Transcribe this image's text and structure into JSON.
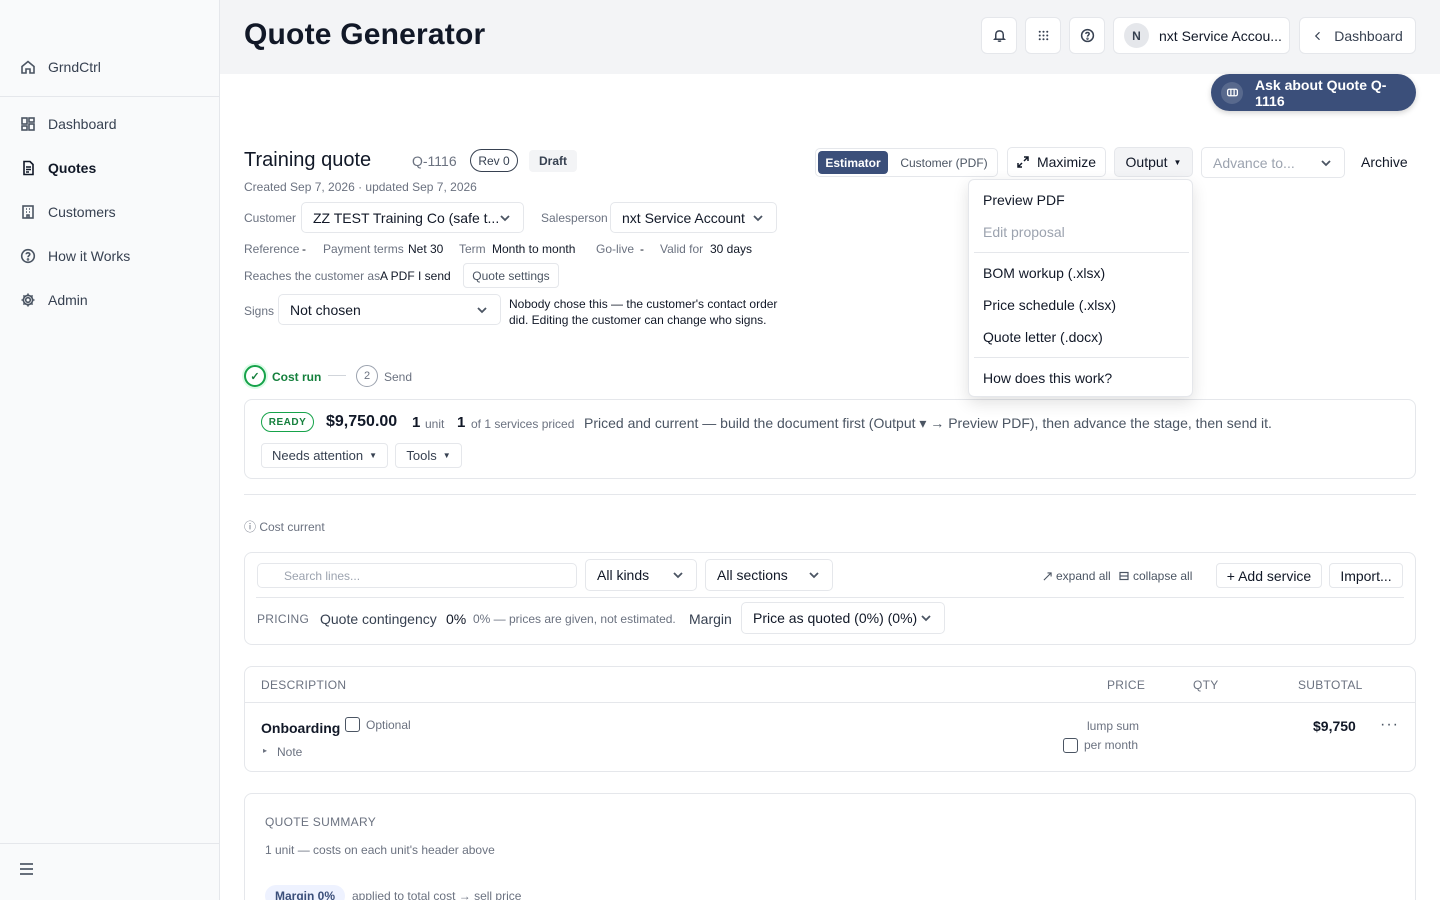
{
  "sidebar": {
    "brand": "GrndCtrl",
    "items": [
      {
        "label": "Dashboard",
        "icon": "dashboard-icon"
      },
      {
        "label": "Quotes",
        "icon": "document-icon"
      },
      {
        "label": "Customers",
        "icon": "building-icon"
      },
      {
        "label": "How it Works",
        "icon": "help-circle-icon"
      },
      {
        "label": "Admin",
        "icon": "gear-icon"
      }
    ]
  },
  "header": {
    "title": "Quote Generator",
    "account_initial": "N",
    "account_name": "nxt Service Accou...",
    "dashboard_link": "Dashboard"
  },
  "ask_button": "Ask about Quote Q-1116",
  "quote": {
    "title": "Training quote",
    "number": "Q-1116",
    "revision": "Rev 0",
    "status": "Draft",
    "created": "Created Sep 7, 2026 · updated Sep 7, 2026",
    "customer_label": "Customer",
    "customer_value": "ZZ TEST Training Co (safe t...",
    "salesperson_label": "Salesperson",
    "salesperson_value": "nxt Service Account",
    "reference_label": "Reference",
    "reference_value": "-",
    "payment_terms_label": "Payment terms",
    "payment_terms_value": "Net 30",
    "term_label": "Term",
    "term_value": "Month to month",
    "golive_label": "Go-live",
    "golive_value": "-",
    "valid_label": "Valid for",
    "valid_value": "30 days",
    "reaches_label": "Reaches the customer as",
    "reaches_value": "A PDF I send",
    "quote_settings": "Quote settings",
    "signs_label": "Signs",
    "signs_value": "Not chosen",
    "signs_note": "Nobody chose this — the customer's contact order did. Editing the customer can change who signs."
  },
  "toolbar": {
    "estimator": "Estimator",
    "customer_pdf": "Customer (PDF)",
    "maximize": "Maximize",
    "output": "Output",
    "advance_placeholder": "Advance to...",
    "archive": "Archive"
  },
  "output_menu": {
    "items": [
      "Preview PDF",
      "Edit proposal",
      "BOM workup (.xlsx)",
      "Price schedule (.xlsx)",
      "Quote letter (.docx)",
      "How does this work?"
    ]
  },
  "steps": [
    {
      "label": "Cost run",
      "number": "✓",
      "state": "done"
    },
    {
      "label": "Send",
      "number": "2",
      "state": "pending"
    }
  ],
  "status_card": {
    "badge": "READY",
    "amount": "$9,750.00",
    "units_count": "1",
    "units_label": "unit",
    "services_count": "1",
    "services_label": "of 1 services priced",
    "message": "Priced and current — build the document first (Output ▾ → Preview PDF), then advance the stage, then send it.",
    "needs_attention": "Needs attention",
    "tools": "Tools"
  },
  "cost_current": "ⓘ Cost current",
  "filters": {
    "search_placeholder": "Search lines...",
    "kinds": "All kinds",
    "sections": "All sections",
    "expand_all": "expand all",
    "collapse_all": "collapse all",
    "add_service": "+ Add service",
    "import": "Import..."
  },
  "pricing": {
    "label": "PRICING",
    "contingency_label": "Quote contingency",
    "contingency_value": "0%",
    "contingency_note": "0% — prices are given, not estimated.",
    "margin_label": "Margin",
    "margin_value": "Price as quoted (0%) (0%)"
  },
  "table": {
    "headers": {
      "description": "DESCRIPTION",
      "price": "PRICE",
      "qty": "QTY",
      "subtotal": "SUBTOTAL"
    },
    "rows": [
      {
        "name": "Onboarding",
        "optional_label": "Optional",
        "note": "Note",
        "price_type": "lump sum",
        "per_month": "per month",
        "subtotal": "$9,750"
      }
    ]
  },
  "summary": {
    "title": "QUOTE SUMMARY",
    "subtitle": "1 unit — costs on each unit's header above",
    "margin_badge": "Margin 0%",
    "margin_note": "applied to total cost → sell price"
  }
}
